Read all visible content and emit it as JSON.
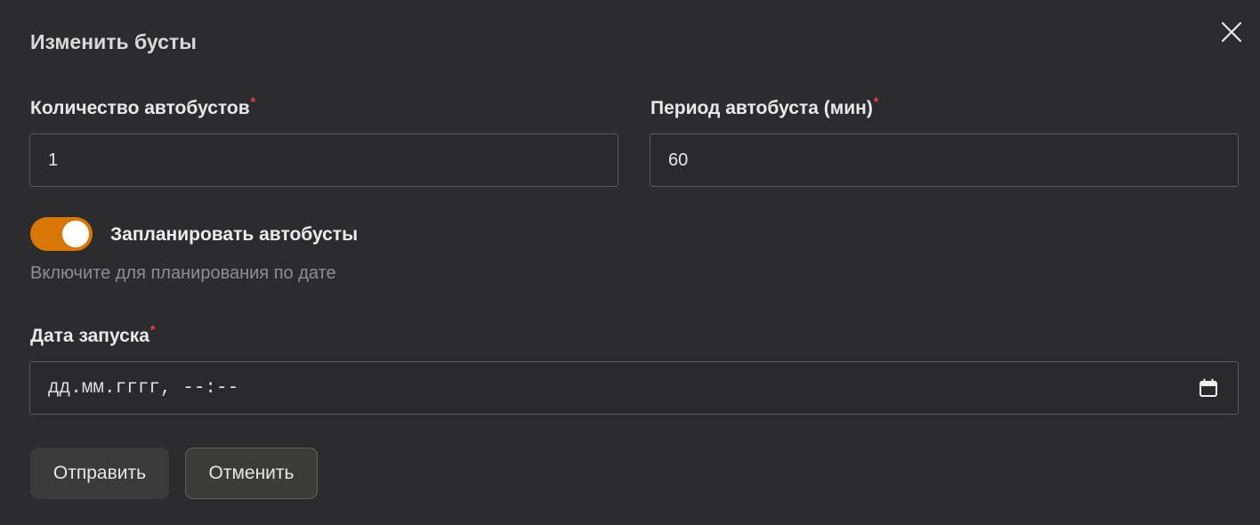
{
  "dialog": {
    "title": "Изменить бусты",
    "close_icon": "close-icon"
  },
  "fields": {
    "count": {
      "label": "Количество автобустов",
      "required": "*",
      "value": "1"
    },
    "period": {
      "label": "Период автобуста (мин)",
      "required": "*",
      "value": "60"
    }
  },
  "schedule": {
    "toggle_label": "Запланировать автобусты",
    "toggle_on": true,
    "hint": "Включите для планирования по дате",
    "accent_color": "#d97706"
  },
  "start_date": {
    "label": "Дата запуска",
    "required": "*",
    "placeholder": "дд.мм.гггг, --:--",
    "icon": "calendar-icon"
  },
  "buttons": {
    "submit": "Отправить",
    "cancel": "Отменить"
  }
}
